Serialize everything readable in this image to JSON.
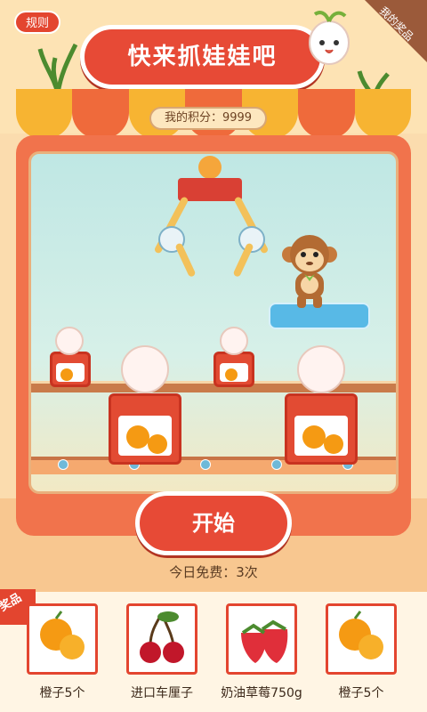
{
  "header": {
    "rules_label": "规则",
    "title": "快来抓娃娃吧",
    "my_prizes_label": "我的奖品"
  },
  "score": {
    "label": "我的积分：9999"
  },
  "start_button": {
    "label": "开始"
  },
  "free_plays": {
    "label": "今日免费：3次"
  },
  "prizes": {
    "tag": "奖品",
    "items": [
      {
        "label": "橙子5个",
        "icon": "orange-icon"
      },
      {
        "label": "进口车厘子",
        "icon": "cherry-icon"
      },
      {
        "label": "奶油草莓750g",
        "icon": "strawberry-icon"
      },
      {
        "label": "橙子5个",
        "icon": "orange-icon"
      }
    ]
  },
  "colors": {
    "accent": "#e74a36",
    "machine": "#f1734c",
    "window": "#bfe7e4"
  }
}
